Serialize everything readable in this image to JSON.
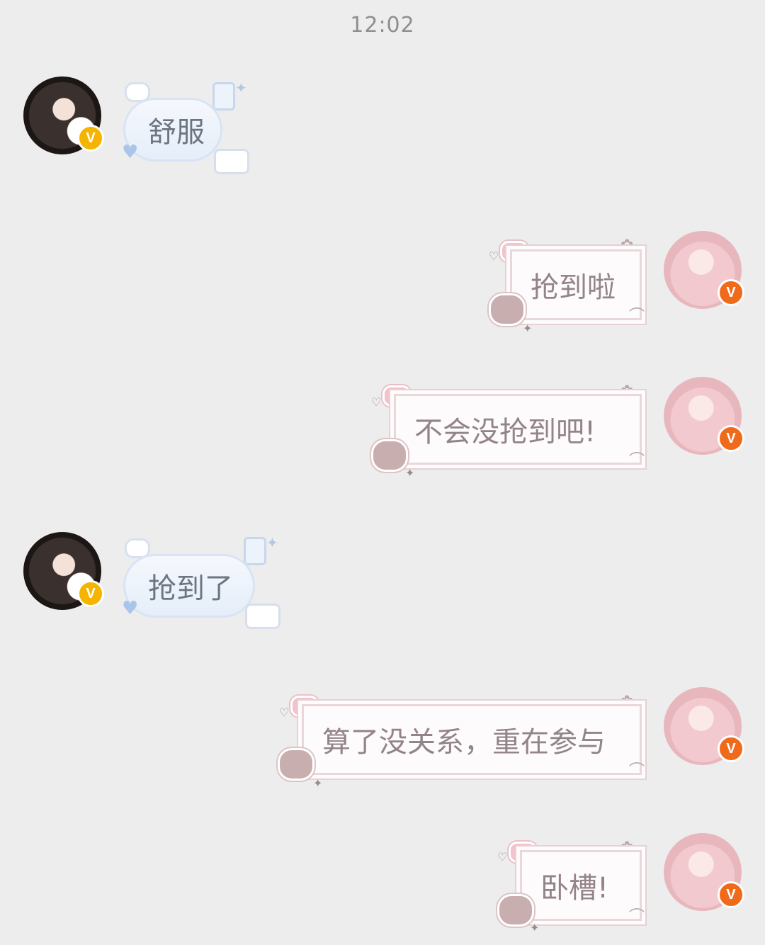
{
  "time": "12:02",
  "badge_letter": "V",
  "messages": [
    {
      "side": "left",
      "text": "舒服"
    },
    {
      "side": "right",
      "text": "抢到啦"
    },
    {
      "side": "right",
      "text": "不会没抢到吧!"
    },
    {
      "side": "left",
      "text": "抢到了"
    },
    {
      "side": "right",
      "text": "算了没关系，重在参与"
    },
    {
      "side": "right",
      "text": "卧槽!"
    }
  ],
  "colors": {
    "background": "#ededed",
    "left_bubble": "#e5eef9",
    "right_bubble": "#fdfbfb",
    "gold_badge": "#f4b400",
    "orange_badge": "#f06a1c"
  },
  "icons": [
    "cloud-icon",
    "heart-icon",
    "bottle-icon",
    "cat-icon",
    "sparkle-icon",
    "bear-icon",
    "bow-icon",
    "paperclip-icon",
    "verified-badge-icon"
  ]
}
